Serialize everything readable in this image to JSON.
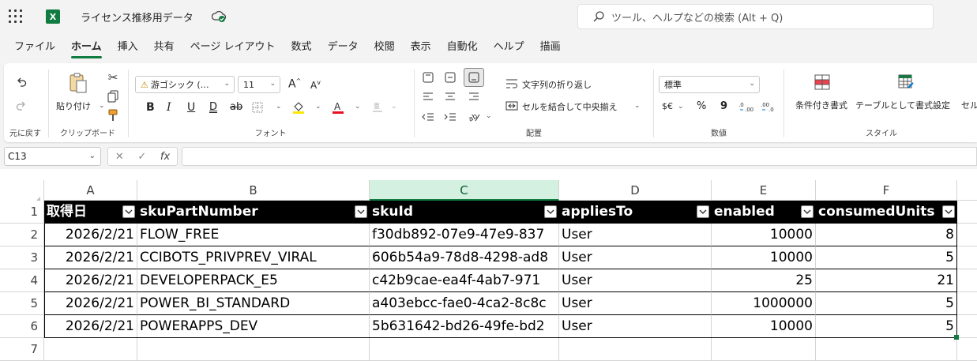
{
  "app": {
    "doc_title": "ライセンス推移用データ",
    "logo_letter": "X",
    "search_placeholder": "ツール、ヘルプなどの検索 (Alt + Q)"
  },
  "tabs": [
    {
      "label": "ファイル"
    },
    {
      "label": "ホーム",
      "active": true
    },
    {
      "label": "挿入"
    },
    {
      "label": "共有"
    },
    {
      "label": "ページ レイアウト"
    },
    {
      "label": "数式"
    },
    {
      "label": "データ"
    },
    {
      "label": "校閲"
    },
    {
      "label": "表示"
    },
    {
      "label": "自動化"
    },
    {
      "label": "ヘルプ"
    },
    {
      "label": "描画"
    }
  ],
  "ribbon": {
    "undo_group_label": "元に戻す",
    "paste_label": "貼り付け",
    "clipboard_label": "クリップボード",
    "font_name": "游ゴシック (…",
    "font_size": "11",
    "font_group_label": "フォント",
    "wrap_text_label": "文字列の折り返し",
    "merge_label": "セルを結合して中央揃え",
    "alignment_group_label": "配置",
    "number_format": "標準",
    "number_group_label": "数値",
    "conditional_label": "条件付き書式",
    "table_format_label": "テーブルとして書式設定",
    "cell_style_label": "セル",
    "style_group_label": "スタイル",
    "bold": "B",
    "italic": "I",
    "underline": "U",
    "font_grow": "A",
    "font_shrink": "A",
    "currency_icon": "$€",
    "percent_icon": "%",
    "comma_icon": "9"
  },
  "formula_bar": {
    "name_box": "C13",
    "fx": "fx",
    "cancel": "✕",
    "enter": "✓",
    "formula": ""
  },
  "grid": {
    "columns": [
      "A",
      "B",
      "C",
      "D",
      "E",
      "F"
    ],
    "selected_column": "C",
    "row_numbers": [
      "1",
      "2",
      "3",
      "4",
      "5",
      "6",
      "7"
    ],
    "headers": [
      "取得日",
      "skuPartNumber",
      "skuId",
      "appliesTo",
      "enabled",
      "consumedUnits"
    ],
    "rows": [
      [
        "2026/2/21",
        "FLOW_FREE",
        "f30db892-07e9-47e9-837",
        "User",
        "10000",
        "8"
      ],
      [
        "2026/2/21",
        "CCIBOTS_PRIVPREV_VIRAL",
        "606b54a9-78d8-4298-ad8",
        "User",
        "10000",
        "5"
      ],
      [
        "2026/2/21",
        "DEVELOPERPACK_E5",
        "c42b9cae-ea4f-4ab7-971",
        "User",
        "25",
        "21"
      ],
      [
        "2026/2/21",
        "POWER_BI_STANDARD",
        "a403ebcc-fae0-4ca2-8c8c",
        "User",
        "1000000",
        "5"
      ],
      [
        "2026/2/21",
        "POWERAPPS_DEV",
        "5b631642-bd26-49fe-bd2",
        "User",
        "10000",
        "5"
      ]
    ]
  },
  "colors": {
    "accent": "#107c41",
    "header_fill": "#000000",
    "selected_col_fill": "#d3f0e0"
  }
}
